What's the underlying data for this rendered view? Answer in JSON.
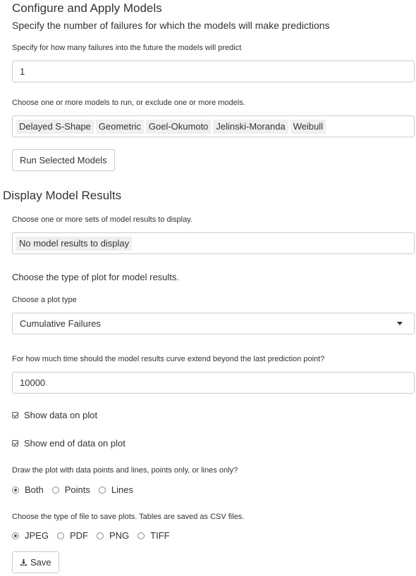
{
  "configure": {
    "title": "Configure and Apply Models",
    "subtitle": "Specify the number of failures for which the models will make predictions",
    "future_label": "Specify for how many failures into the future the models will predict",
    "future_value": "1",
    "models_label": "Choose one or more models to run, or exclude one or more models.",
    "models": [
      "Delayed S-Shape",
      "Geometric",
      "Goel-Okumoto",
      "Jelinski-Moranda",
      "Weibull"
    ],
    "run_button": "Run Selected Models"
  },
  "display": {
    "title": "Display Model Results",
    "results_label": "Choose one or more sets of model results to display.",
    "results_value": "No model results to display",
    "plot_type_heading": "Choose the type of plot for model results.",
    "plot_type_label": "Choose a plot type",
    "plot_type_value": "Cumulative Failures",
    "extend_label": "For how much time should the model results curve extend beyond the last prediction point?",
    "extend_value": "10000",
    "show_data_label": "Show data on plot",
    "show_data_checked": true,
    "show_end_label": "Show end of data on plot",
    "show_end_checked": true,
    "draw_label": "Draw the plot with data points and lines, points only, or lines only?",
    "draw_options": [
      {
        "label": "Both",
        "selected": true
      },
      {
        "label": "Points",
        "selected": false
      },
      {
        "label": "Lines",
        "selected": false
      }
    ],
    "file_label": "Choose the type of file to save plots. Tables are saved as CSV files.",
    "file_options": [
      {
        "label": "JPEG",
        "selected": true
      },
      {
        "label": "PDF",
        "selected": false
      },
      {
        "label": "PNG",
        "selected": false
      },
      {
        "label": "TIFF",
        "selected": false
      }
    ],
    "save_button": "Save",
    "save_icon": "download-icon"
  }
}
